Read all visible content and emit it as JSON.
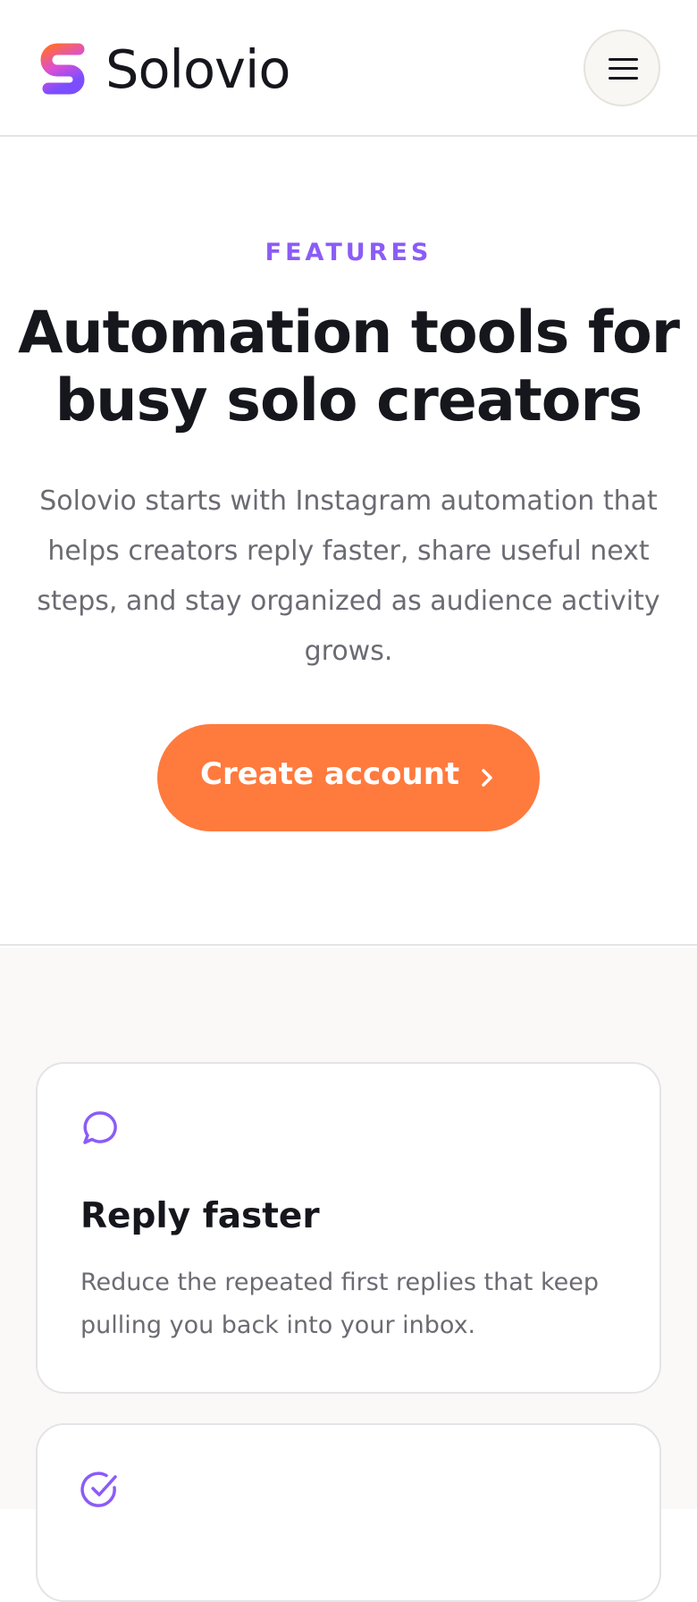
{
  "header": {
    "brand": "Solovio",
    "menu_label": "Menu"
  },
  "hero": {
    "eyebrow": "FEATURES",
    "headline": "Automation tools for busy solo creators",
    "subtext": "Solovio starts with Instagram automation that helps creators reply faster, share useful next steps, and stay organized as audience activity grows.",
    "cta_label": "Create account"
  },
  "features": [
    {
      "icon": "chat-bubble-icon",
      "title": "Reply faster",
      "description": "Reduce the repeated first replies that keep pulling you back into your inbox."
    },
    {
      "icon": "check-circle-icon",
      "title": "",
      "description": ""
    }
  ],
  "colors": {
    "accent_purple": "#8b5cf6",
    "accent_orange": "#ff7a3d",
    "text_dark": "#16161d",
    "text_muted": "#6b6b73"
  }
}
